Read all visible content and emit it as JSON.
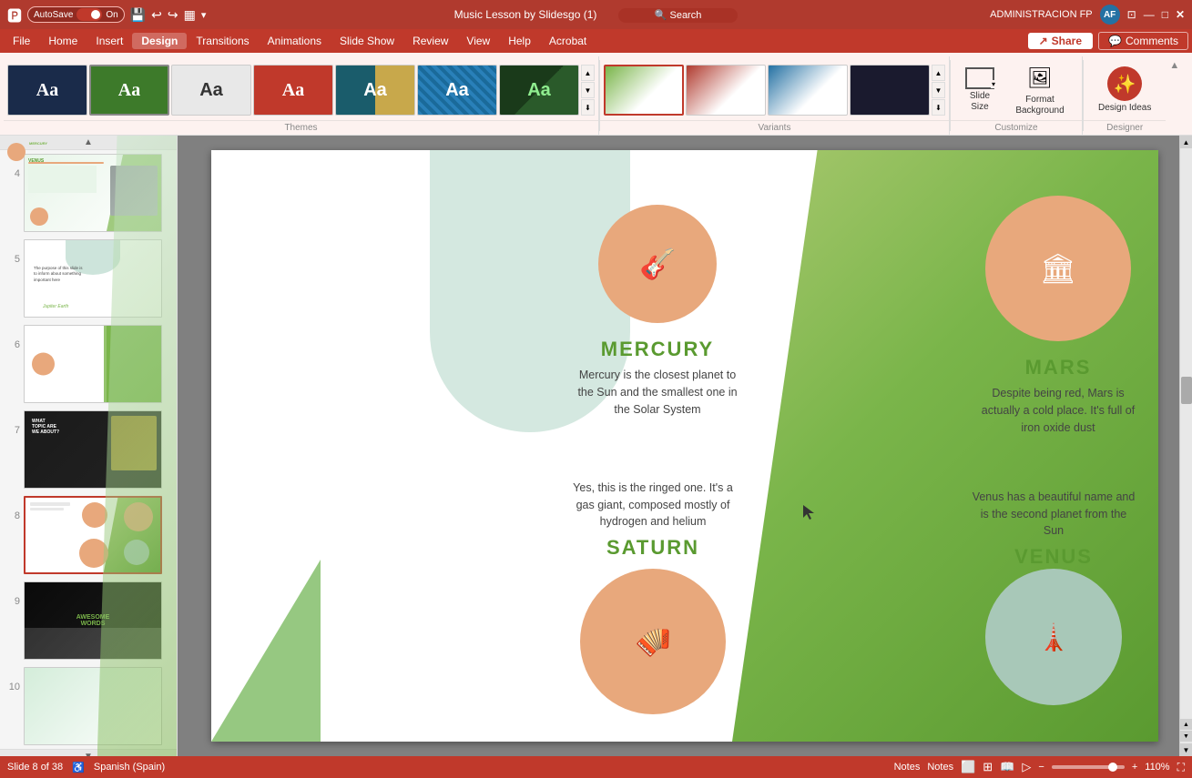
{
  "titleBar": {
    "autosave": "AutoSave",
    "on": "On",
    "title": "Music Lesson by Slidesgo (1)",
    "user": "ADMINISTRACION FP",
    "userInitials": "AF",
    "minBtn": "—",
    "maxBtn": "□",
    "closeBtn": "✕"
  },
  "menuBar": {
    "items": [
      "File",
      "Home",
      "Insert",
      "Design",
      "Transitions",
      "Animations",
      "Slide Show",
      "Review",
      "View",
      "Help",
      "Acrobat"
    ],
    "activeItem": "Design",
    "share": "Share",
    "comments": "Comments",
    "searchPlaceholder": "Search"
  },
  "ribbon": {
    "themes": {
      "sectionLabel": "Themes",
      "items": [
        {
          "id": "t1",
          "label": "Aa",
          "style": "dark"
        },
        {
          "id": "t2",
          "label": "Aa",
          "style": "green"
        },
        {
          "id": "t3",
          "label": "Aa",
          "style": "light"
        },
        {
          "id": "t4",
          "label": "Aa",
          "style": "orange"
        },
        {
          "id": "t5",
          "label": "Aa",
          "style": "teal-gold"
        },
        {
          "id": "t6",
          "label": "Aa",
          "style": "pattern"
        },
        {
          "id": "t7",
          "label": "Aa",
          "style": "dark-green"
        }
      ]
    },
    "variants": {
      "sectionLabel": "Variants",
      "items": [
        {
          "id": "v1",
          "style": "v1",
          "active": true
        },
        {
          "id": "v2",
          "style": "v2"
        },
        {
          "id": "v3",
          "style": "v3"
        },
        {
          "id": "v4",
          "style": "v4"
        }
      ]
    },
    "customize": {
      "sectionLabel": "Customize",
      "slideSize": "Slide\nSize",
      "formatBackground": "Format Background",
      "designIdeas": "Design Ideas"
    }
  },
  "slidePanel": {
    "slides": [
      {
        "num": 4,
        "id": "s4"
      },
      {
        "num": 5,
        "id": "s5"
      },
      {
        "num": 6,
        "id": "s6"
      },
      {
        "num": 7,
        "id": "s7"
      },
      {
        "num": 8,
        "id": "s8",
        "active": true
      },
      {
        "num": 9,
        "id": "s9"
      },
      {
        "num": 10,
        "id": "s10"
      }
    ]
  },
  "slide8": {
    "mercury": {
      "title": "MERCURY",
      "desc": "Mercury is the closest planet to the Sun and the smallest one in the Solar System"
    },
    "mars": {
      "title": "MARS",
      "desc": "Despite being red, Mars is actually a cold place. It's full of iron oxide dust"
    },
    "saturn": {
      "title": "SATURN",
      "desc": "Yes, this is the ringed one. It's a gas giant, composed mostly of hydrogen and helium"
    },
    "venus": {
      "title": "VENUS",
      "desc": "Venus has a beautiful name and is the second planet from the Sun"
    }
  },
  "statusBar": {
    "slideInfo": "Slide 8 of 38",
    "language": "Spanish (Spain)",
    "notes": "Notes",
    "zoom": "110%",
    "accessibility": "♿"
  }
}
